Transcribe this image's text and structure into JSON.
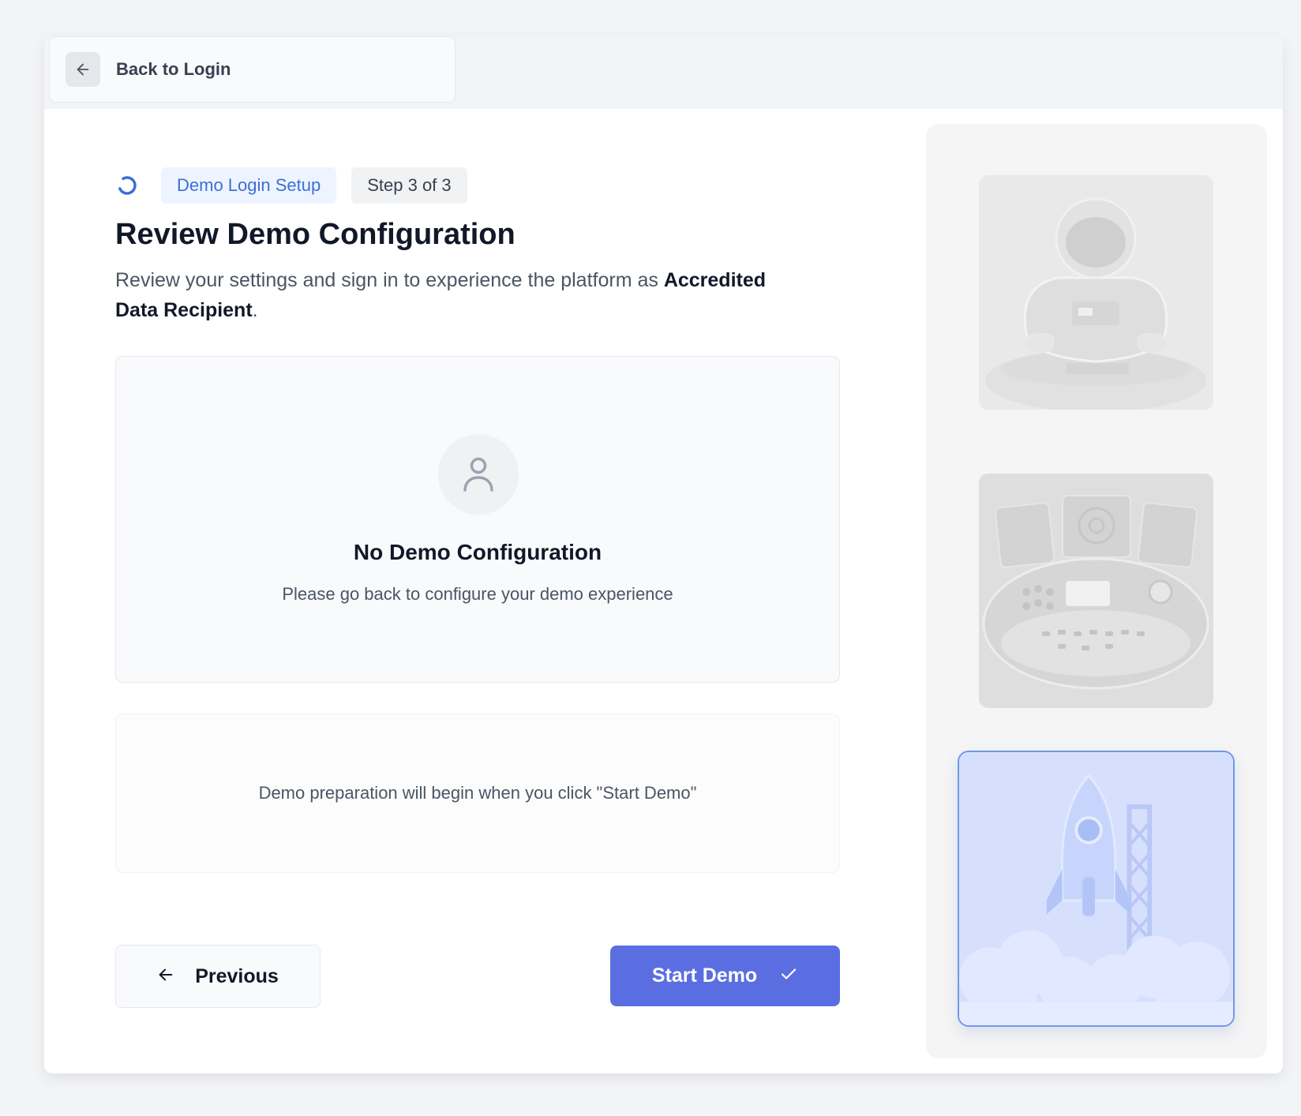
{
  "nav": {
    "back_label": "Back to Login",
    "back_icon": "arrow-left-icon"
  },
  "header": {
    "badge_label": "Demo Login Setup",
    "step_label": "Step 3 of 3",
    "status_icon": "loading-spinner-icon"
  },
  "page": {
    "title": "Review Demo Configuration",
    "description_prefix": "Review your settings and sign in to experience the platform as ",
    "description_role": "Accredited Data Recipient",
    "description_suffix": "."
  },
  "empty_state": {
    "icon": "user-icon",
    "title": "No Demo Configuration",
    "subtitle": "Please go back to configure your demo experience"
  },
  "preparation": {
    "text": "Demo preparation will begin when you click \"Start Demo\""
  },
  "actions": {
    "previous_label": "Previous",
    "start_label": "Start Demo",
    "start_icon": "check-icon"
  },
  "illustrations": {
    "items": [
      {
        "name": "astronaut-illustration",
        "active": false
      },
      {
        "name": "control-panel-illustration",
        "active": false
      },
      {
        "name": "rocket-launch-illustration",
        "active": true
      }
    ]
  },
  "colors": {
    "accent": "#5b6ee1",
    "badge_text": "#3b6fd8",
    "badge_bg": "#eef4ff",
    "active_border": "#6f9ae6"
  }
}
